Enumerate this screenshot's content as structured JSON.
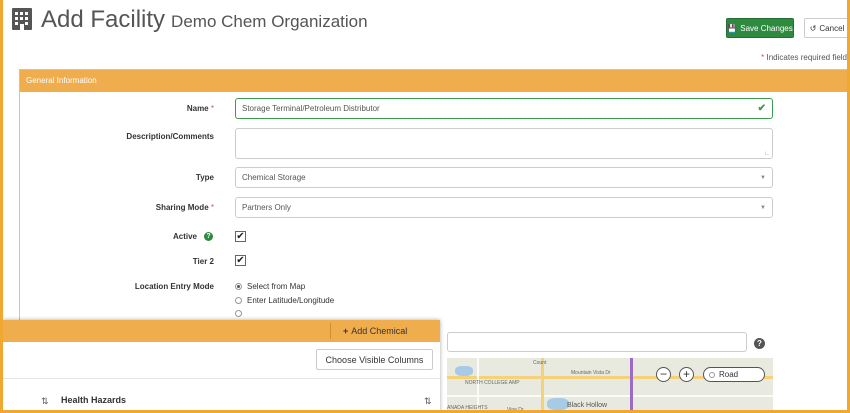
{
  "header": {
    "title": "Add Facility",
    "organization": "Demo Chem Organization",
    "save_label": "Save Changes",
    "cancel_label": "Cancel",
    "required_note_star": "*",
    "required_note": " Indicates required field"
  },
  "panel": {
    "heading": "General Information"
  },
  "form": {
    "name_label": "Name",
    "name_value": "Storage Terminal/Petroleum Distributor",
    "description_label": "Description/Comments",
    "description_value": "",
    "type_label": "Type",
    "type_value": "Chemical Storage",
    "sharing_label": "Sharing Mode",
    "sharing_value": "Partners Only",
    "active_label": "Active",
    "active_checked": true,
    "tier2_label": "Tier 2",
    "tier2_checked": true,
    "location_label": "Location Entry Mode",
    "location_options": [
      "Select from Map",
      "Enter Latitude/Longitude"
    ],
    "location_selected": "Select from Map",
    "required_star": "*"
  },
  "map": {
    "labels": [
      "Mountain Vista Dr",
      "NORTH COLLEGE AMP",
      "ANADA HEIGHTS",
      "Black Hollow",
      "Vine Dr",
      "Count"
    ],
    "zoom_out": "−",
    "zoom_in": "+",
    "layer_option": "Road"
  },
  "overlay": {
    "add_chemical_label": "Add Chemical",
    "choose_columns_label": "Choose Visible Columns",
    "column_header": "Health Hazards"
  },
  "colors": {
    "accent_orange": "#f0ad4e",
    "save_green": "#2e8a3f",
    "required_red": "#d9534f"
  },
  "icons": [
    "building-icon",
    "save-icon",
    "undo-icon",
    "check-icon",
    "caret-down-icon",
    "help-icon",
    "plus-icon",
    "sort-icon"
  ]
}
